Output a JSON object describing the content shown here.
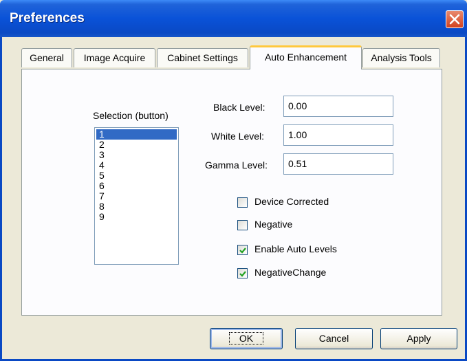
{
  "window": {
    "title": "Preferences"
  },
  "tabs": [
    {
      "label": "General"
    },
    {
      "label": "Image Acquire"
    },
    {
      "label": "Cabinet Settings"
    },
    {
      "label": "Auto Enhancement"
    },
    {
      "label": "Analysis Tools"
    }
  ],
  "selection": {
    "label": "Selection (button)",
    "items": [
      "1",
      "2",
      "3",
      "4",
      "5",
      "6",
      "7",
      "8",
      "9"
    ],
    "selected": "1"
  },
  "levels": {
    "black": {
      "label": "Black Level:",
      "value": "0.00"
    },
    "white": {
      "label": "White Level:",
      "value": "1.00"
    },
    "gamma": {
      "label": "Gamma Level:",
      "value": "0.51"
    }
  },
  "options": [
    {
      "label": "Device Corrected",
      "checked": false
    },
    {
      "label": "Negative",
      "checked": false
    },
    {
      "label": "Enable Auto Levels",
      "checked": true
    },
    {
      "label": "NegativeChange",
      "checked": true
    }
  ],
  "buttons": {
    "ok": "OK",
    "cancel": "Cancel",
    "apply": "Apply"
  },
  "colors": {
    "titlebar": "#0a52d8",
    "selection": "#316ac5",
    "active_tab_accent": "#ffc83c",
    "close": "#d3411e"
  }
}
